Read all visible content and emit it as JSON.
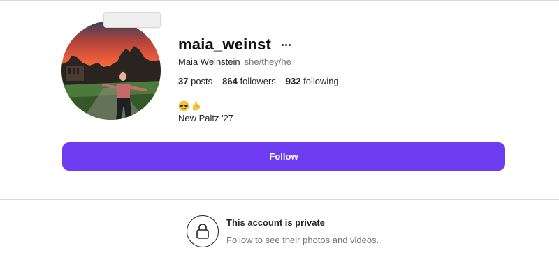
{
  "profile": {
    "username": "maia_weinst",
    "full_name": "Maia Weinstein",
    "pronouns": "she/they/he",
    "stats": [
      {
        "value": "37",
        "label": "posts"
      },
      {
        "value": "864",
        "label": "followers"
      },
      {
        "value": "932",
        "label": "following"
      }
    ],
    "bio_emojis": [
      "smiling-face-with-sunglasses-emoji",
      "flexed-biceps-emoji"
    ],
    "bio_line": "New Paltz '27"
  },
  "actions": {
    "follow_label": "Follow"
  },
  "private_notice": {
    "title": "This account is private",
    "subtitle": "Follow to see their photos and videos."
  },
  "colors": {
    "follow_button": "#6d3bf0",
    "divider": "#dbdbdb",
    "secondary_text": "#737373"
  }
}
